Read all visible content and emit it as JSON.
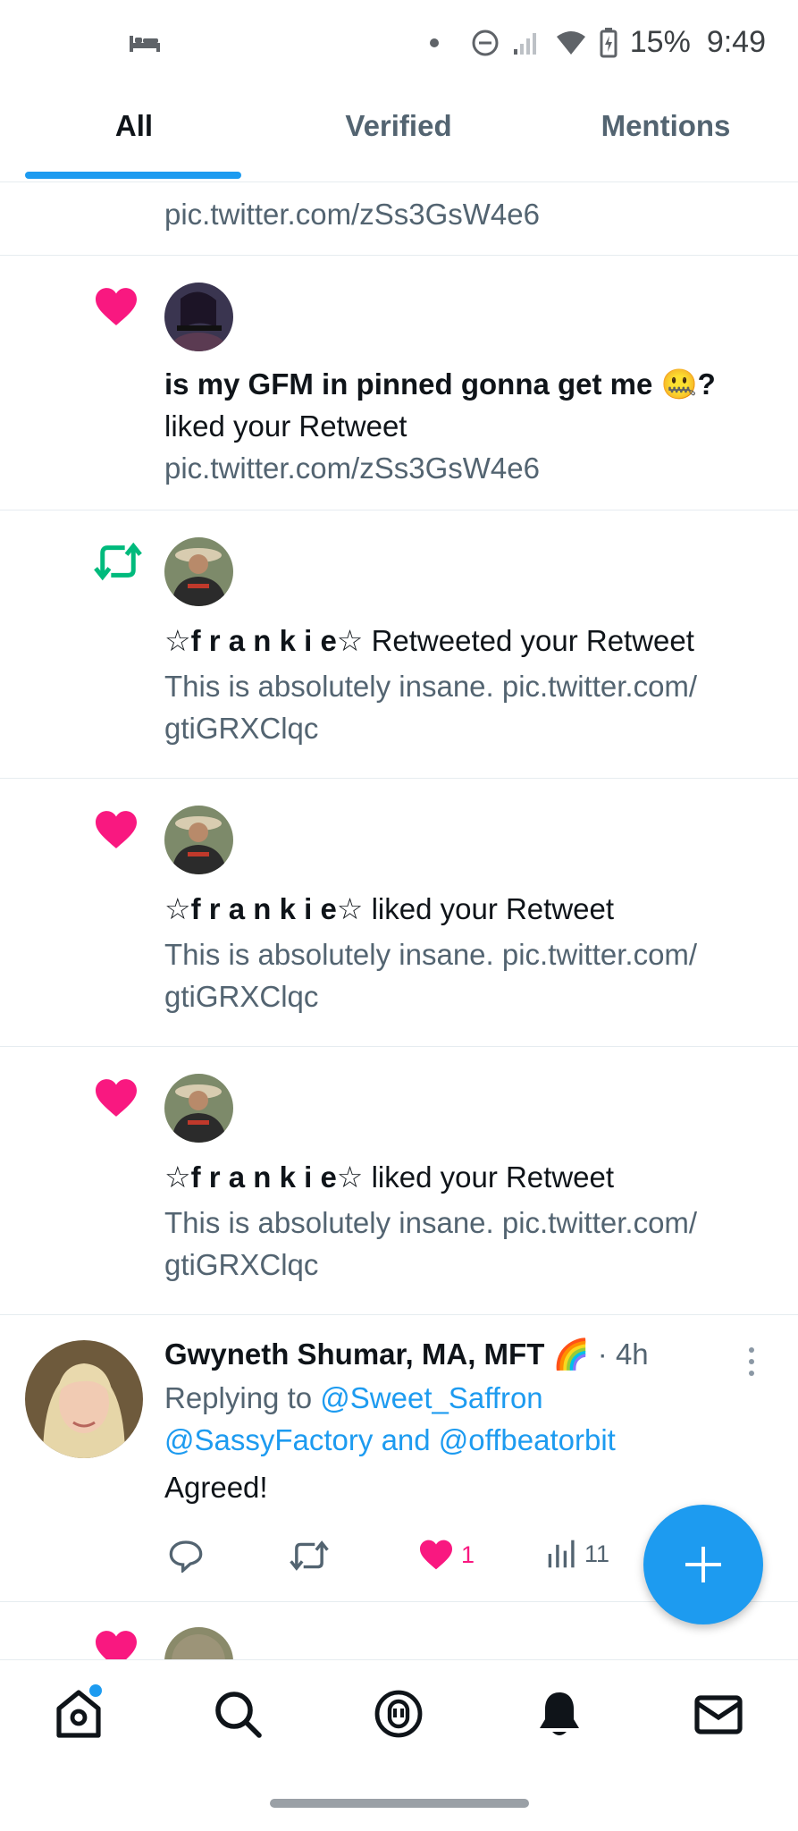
{
  "status_bar": {
    "battery": "15%",
    "time": "9:49"
  },
  "tabs": [
    {
      "label": "All",
      "active": true
    },
    {
      "label": "Verified",
      "active": false
    },
    {
      "label": "Mentions",
      "active": false
    }
  ],
  "feed": {
    "partial_top_link": "pic.twitter.com/zSs3GsW4e6",
    "notifications": [
      {
        "type": "like",
        "icon": "heart-icon",
        "actor": "is my GFM in pinned gonna get me 🤐?",
        "action": "liked your Retweet",
        "text": "pic.twitter.com/zSs3GsW4e6"
      },
      {
        "type": "retweet",
        "icon": "retweet-icon",
        "actor": "☆f r a n k i e☆",
        "action": "Retweeted your Retweet",
        "text_line1": "This is absolutely insane. pic.twitter.com/",
        "text_line2": "gtiGRXClqc"
      },
      {
        "type": "like",
        "icon": "heart-icon",
        "actor": "☆f r a n k i e☆",
        "action": "liked your Retweet",
        "text_line1": "This is absolutely insane. pic.twitter.com/",
        "text_line2": "gtiGRXClqc"
      },
      {
        "type": "like",
        "icon": "heart-icon",
        "actor": "☆f r a n k i e☆",
        "action": "liked your Retweet",
        "text_line1": "This is absolutely insane. pic.twitter.com/",
        "text_line2": "gtiGRXClqc"
      }
    ],
    "reply_tweet": {
      "author": "Gwyneth Shumar, MA, MFT 🌈",
      "time": "· 4h",
      "replying_prefix": "Replying to",
      "mention1": "@Sweet_Saffron",
      "mention2": "@SassyFactory",
      "and": "and",
      "mention3": "@offbeatorbit",
      "text": "Agreed!",
      "likes": "1",
      "views": "11"
    }
  },
  "colors": {
    "accent": "#1d9bf0",
    "like": "#f91880",
    "retweet": "#00ba7c",
    "muted": "#536471"
  }
}
